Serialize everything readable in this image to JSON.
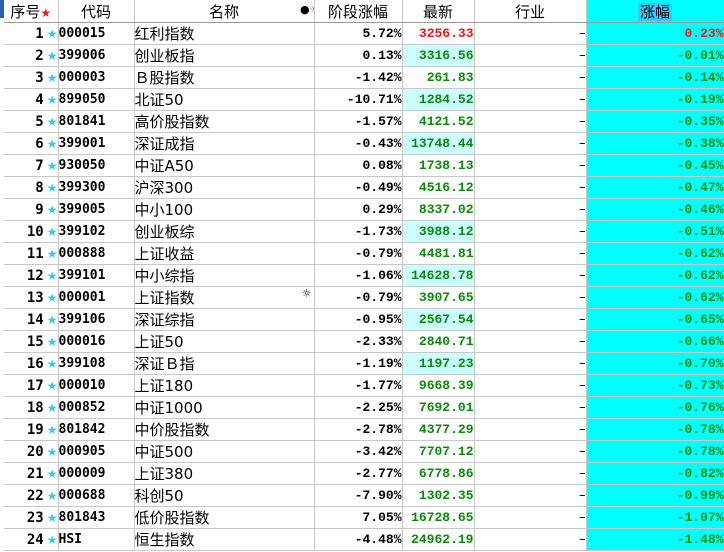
{
  "header": {
    "seq": "序号",
    "code": "代码",
    "name": "名称",
    "stage_change": "阶段涨幅",
    "latest": "最新",
    "industry": "行业",
    "change": "涨幅"
  },
  "colors": {
    "up": "#e8181b",
    "down": "#0a8a0a",
    "highlight_cell": "#ccffff",
    "change_column_bg": "#00ffff",
    "star": "#3ec5e8"
  },
  "rows": [
    {
      "seq": "1",
      "code": "000015",
      "name": "红利指数",
      "stage": "5.72%",
      "latest": "3256.33",
      "ind": "–",
      "chg": "0.23%",
      "dir": "up",
      "hl": false,
      "mark": ""
    },
    {
      "seq": "2",
      "code": "399006",
      "name": "创业板指",
      "stage": "0.13%",
      "latest": "3316.56",
      "ind": "–",
      "chg": "-0.01%",
      "dir": "down",
      "hl": true,
      "mark": ""
    },
    {
      "seq": "3",
      "code": "000003",
      "name": "Ｂ股指数",
      "stage": "-1.42%",
      "latest": "261.83",
      "ind": "–",
      "chg": "-0.14%",
      "dir": "down",
      "hl": false,
      "mark": ""
    },
    {
      "seq": "4",
      "code": "899050",
      "name": "北证50",
      "stage": "-10.71%",
      "latest": "1284.52",
      "ind": "–",
      "chg": "-0.19%",
      "dir": "down",
      "hl": true,
      "mark": ""
    },
    {
      "seq": "5",
      "code": "801841",
      "name": "高价股指数",
      "stage": "-1.57%",
      "latest": "4121.52",
      "ind": "–",
      "chg": "-0.35%",
      "dir": "down",
      "hl": false,
      "mark": ""
    },
    {
      "seq": "6",
      "code": "399001",
      "name": "深证成指",
      "stage": "-0.43%",
      "latest": "13748.44",
      "ind": "–",
      "chg": "-0.38%",
      "dir": "down",
      "hl": true,
      "mark": ""
    },
    {
      "seq": "7",
      "code": "930050",
      "name": "中证A50",
      "stage": "0.08%",
      "latest": "1738.13",
      "ind": "–",
      "chg": "-0.45%",
      "dir": "down",
      "hl": false,
      "mark": ""
    },
    {
      "seq": "8",
      "code": "399300",
      "name": "沪深300",
      "stage": "-0.49%",
      "latest": "4516.12",
      "ind": "–",
      "chg": "-0.47%",
      "dir": "down",
      "hl": false,
      "mark": ""
    },
    {
      "seq": "9",
      "code": "399005",
      "name": "中小100",
      "stage": "0.29%",
      "latest": "8337.02",
      "ind": "–",
      "chg": "-0.46%",
      "dir": "down",
      "hl": false,
      "mark": ""
    },
    {
      "seq": "10",
      "code": "399102",
      "name": "创业板综",
      "stage": "-1.73%",
      "latest": "3988.12",
      "ind": "–",
      "chg": "-0.51%",
      "dir": "down",
      "hl": true,
      "mark": ""
    },
    {
      "seq": "11",
      "code": "000888",
      "name": "上证收益",
      "stage": "-0.79%",
      "latest": "4481.81",
      "ind": "–",
      "chg": "-0.62%",
      "dir": "down",
      "hl": false,
      "mark": ""
    },
    {
      "seq": "12",
      "code": "399101",
      "name": "中小综指",
      "stage": "-1.06%",
      "latest": "14628.78",
      "ind": "–",
      "chg": "-0.62%",
      "dir": "down",
      "hl": true,
      "mark": ""
    },
    {
      "seq": "13",
      "code": "000001",
      "name": "上证指数",
      "stage": "-0.79%",
      "latest": "3907.65",
      "ind": "–",
      "chg": "-0.62%",
      "dir": "down",
      "hl": false,
      "mark": "☼"
    },
    {
      "seq": "14",
      "code": "399106",
      "name": "深证综指",
      "stage": "-0.95%",
      "latest": "2567.54",
      "ind": "–",
      "chg": "-0.65%",
      "dir": "down",
      "hl": true,
      "mark": ""
    },
    {
      "seq": "15",
      "code": "000016",
      "name": "上证50",
      "stage": "-2.33%",
      "latest": "2840.71",
      "ind": "–",
      "chg": "-0.66%",
      "dir": "down",
      "hl": false,
      "mark": ""
    },
    {
      "seq": "16",
      "code": "399108",
      "name": "深证Ｂ指",
      "stage": "-1.19%",
      "latest": "1197.23",
      "ind": "–",
      "chg": "-0.70%",
      "dir": "down",
      "hl": true,
      "mark": ""
    },
    {
      "seq": "17",
      "code": "000010",
      "name": "上证180",
      "stage": "-1.77%",
      "latest": "9668.39",
      "ind": "–",
      "chg": "-0.73%",
      "dir": "down",
      "hl": false,
      "mark": ""
    },
    {
      "seq": "18",
      "code": "000852",
      "name": "中证1000",
      "stage": "-2.25%",
      "latest": "7692.01",
      "ind": "–",
      "chg": "-0.76%",
      "dir": "down",
      "hl": false,
      "mark": ""
    },
    {
      "seq": "19",
      "code": "801842",
      "name": "中价股指数",
      "stage": "-2.78%",
      "latest": "4377.29",
      "ind": "–",
      "chg": "-0.78%",
      "dir": "down",
      "hl": false,
      "mark": ""
    },
    {
      "seq": "20",
      "code": "000905",
      "name": "中证500",
      "stage": "-3.42%",
      "latest": "7707.12",
      "ind": "–",
      "chg": "-0.78%",
      "dir": "down",
      "hl": false,
      "mark": ""
    },
    {
      "seq": "21",
      "code": "000009",
      "name": "上证380",
      "stage": "-2.77%",
      "latest": "6778.86",
      "ind": "–",
      "chg": "-0.82%",
      "dir": "down",
      "hl": false,
      "mark": ""
    },
    {
      "seq": "22",
      "code": "000688",
      "name": "科创50",
      "stage": "-7.90%",
      "latest": "1302.35",
      "ind": "–",
      "chg": "-0.99%",
      "dir": "down",
      "hl": false,
      "mark": ""
    },
    {
      "seq": "23",
      "code": "801843",
      "name": "低价股指数",
      "stage": "7.05%",
      "latest": "16728.65",
      "ind": "–",
      "chg": "-1.07%",
      "dir": "down",
      "hl": false,
      "mark": ""
    },
    {
      "seq": "24",
      "code": "HSI",
      "name": "恒生指数",
      "stage": "-4.48%",
      "latest": "24962.19",
      "ind": "–",
      "chg": "-1.48%",
      "dir": "down",
      "hl": false,
      "mark": ""
    }
  ]
}
